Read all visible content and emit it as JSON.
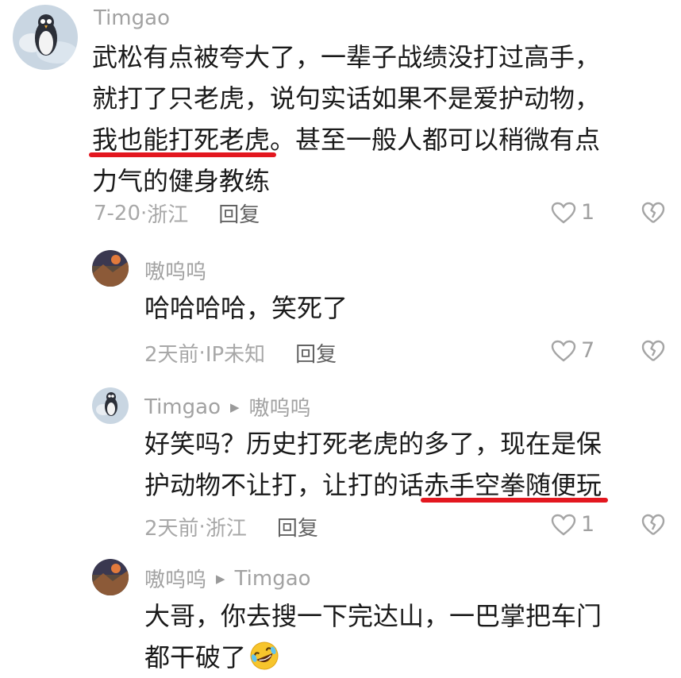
{
  "comments": [
    {
      "author": "Timgao",
      "text_lines": [
        {
          "plain": "武松有点被夸大了，一辈子战绩没打过高手，"
        },
        {
          "plain": "就打了只老虎，说句实话如果不是爱护动物，"
        },
        {
          "hl": "我也能打死老虎",
          "after": "。甚至一般人都可以稍微有点"
        },
        {
          "plain": "力气的健身教练"
        }
      ],
      "date": "7-20",
      "location": "浙江",
      "reply_label": "回复",
      "likes": "1"
    },
    {
      "author": "嗷呜呜",
      "text_lines": [
        {
          "plain": "哈哈哈哈，笑死了"
        }
      ],
      "date": "2天前",
      "location": "IP未知",
      "reply_label": "回复",
      "likes": "7"
    },
    {
      "author": "Timgao",
      "reply_to": "嗷呜呜",
      "text_lines": [
        {
          "plain": "好笑吗？历史打死老虎的多了，现在是保"
        },
        {
          "before": "护动物不让打，让打的话",
          "hl": "赤手空拳随便玩"
        }
      ],
      "date": "2天前",
      "location": "浙江",
      "reply_label": "回复",
      "likes": "1"
    },
    {
      "author": "嗷呜呜",
      "reply_to": "Timgao",
      "text_lines": [
        {
          "plain": "大哥，你去搜一下完达山，一巴掌把车门"
        },
        {
          "plain": "都干破了",
          "emoji": "rolling-laughing-emoji"
        }
      ]
    }
  ],
  "icons": {
    "like": "heart-outline-icon",
    "dislike": "broken-heart-icon",
    "reply_arrow": "triangle-right-icon"
  },
  "colors": {
    "highlight_underline": "#e3171f",
    "muted_text": "#a8a8a8"
  }
}
